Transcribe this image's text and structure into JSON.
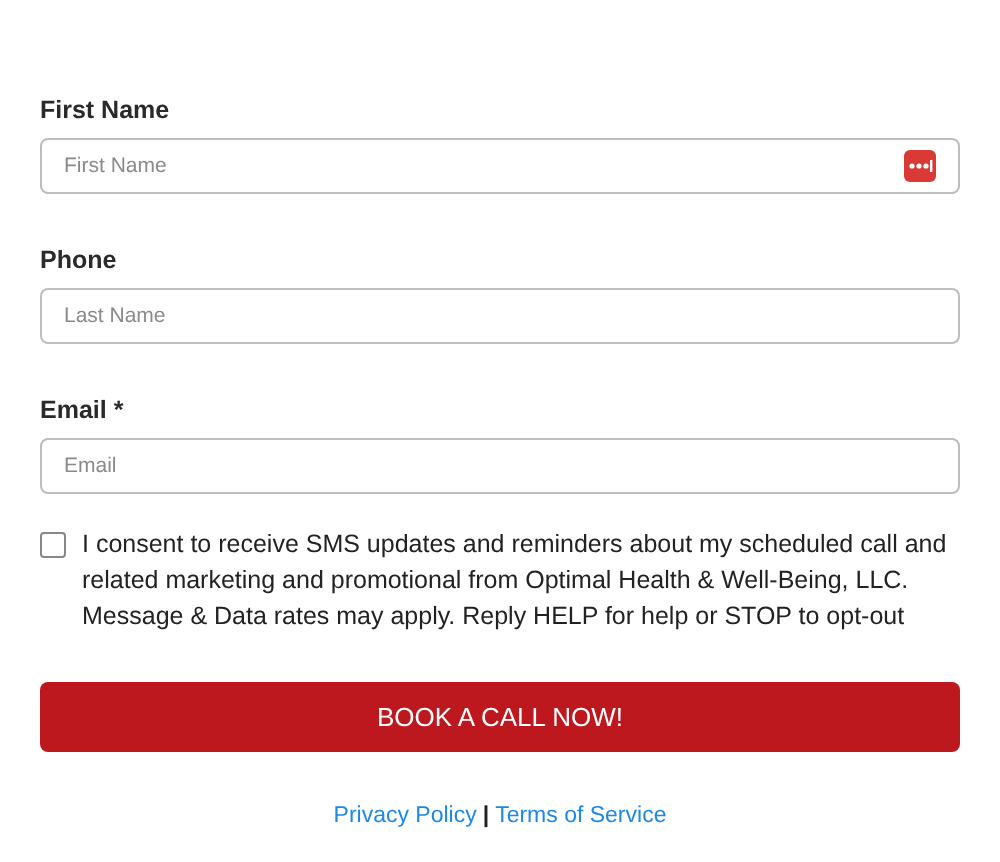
{
  "fields": [
    {
      "label": "First Name",
      "placeholder": "First Name",
      "autofill_icon": true
    },
    {
      "label": "Phone",
      "placeholder": "Last Name"
    },
    {
      "label": "Email *",
      "placeholder": "Email"
    }
  ],
  "consent": {
    "checked": false,
    "text": "I consent to receive SMS updates and reminders about my scheduled call and related marketing and promotional from Optimal Health & Well-Being, LLC. Message & Data rates may apply. Reply HELP for help or STOP to opt-out"
  },
  "submit_button": "BOOK A CALL NOW!",
  "footer_links": [
    {
      "label": "Privacy Policy"
    },
    {
      "label": "Terms of Service"
    }
  ],
  "footer_separator": "|"
}
